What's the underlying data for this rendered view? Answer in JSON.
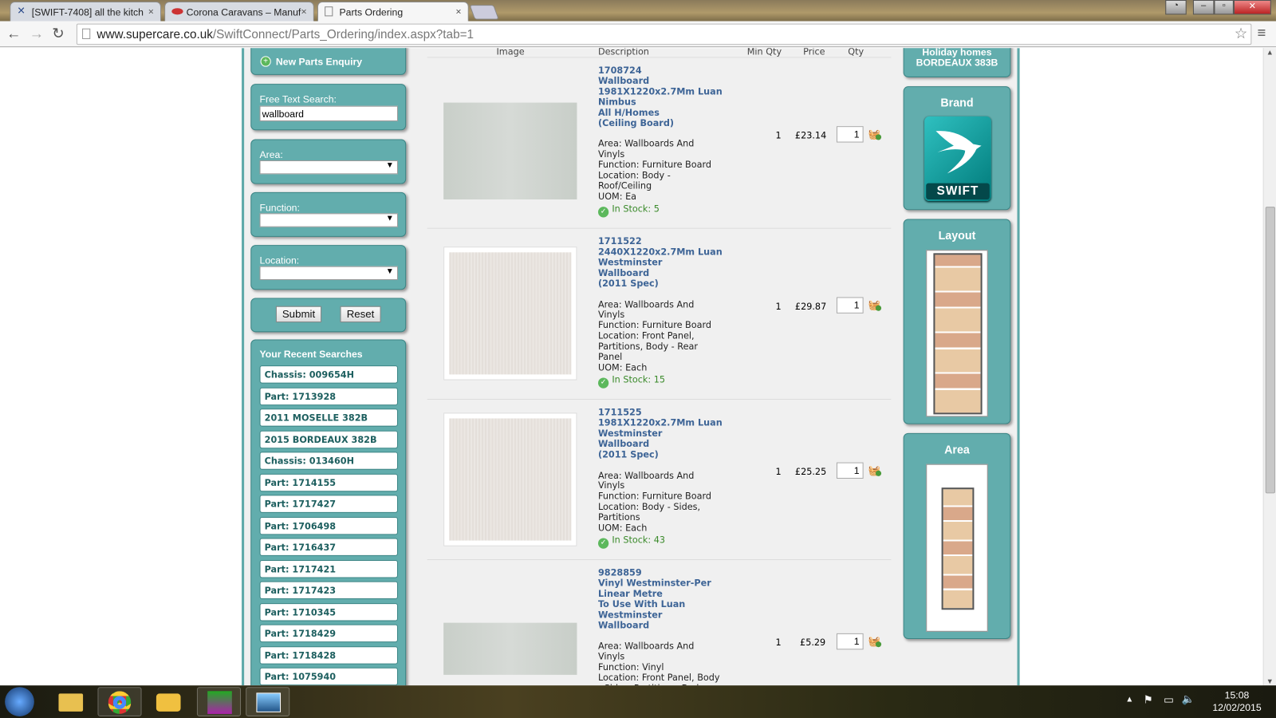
{
  "browser": {
    "tabs": [
      {
        "title": "[SWIFT-7408] all the kitch"
      },
      {
        "title": "Corona Caravans – Manuf"
      },
      {
        "title": "Parts Ordering"
      }
    ],
    "url_host": "www.supercare.co.uk",
    "url_path": "/SwiftConnect/Parts_Ordering/index.aspx?tab=1"
  },
  "sidebar": {
    "new_enquiry": "New Parts Enquiry",
    "free_text_label": "Free Text Search:",
    "free_text_value": "wallboard",
    "area_label": "Area:",
    "function_label": "Function:",
    "location_label": "Location:",
    "submit": "Submit",
    "reset": "Reset",
    "recent_title": "Your Recent Searches",
    "recent": [
      "Chassis: 009654H",
      "Part: 1713928",
      "2011 MOSELLE 382B",
      "2015 BORDEAUX 382B",
      "Chassis: 013460H",
      "Part: 1714155",
      "Part: 1717427",
      "Part: 1706498",
      "Part: 1716437",
      "Part: 1717421",
      "Part: 1717423",
      "Part: 1710345",
      "Part: 1718429",
      "Part: 1718428",
      "Part: 1075940"
    ]
  },
  "results": {
    "headers": {
      "image": "Image",
      "description": "Description",
      "min_qty": "Min Qty",
      "price": "Price",
      "qty": "Qty"
    },
    "rows": [
      {
        "title": "1708724\nWallboard\n1981X1220x2.7Mm Luan\nNimbus\nAll H/Homes\n(Ceiling Board)",
        "details": "Area: Wallboards And\nVinyls\nFunction: Furniture Board\nLocation: Body -\nRoof/Ceiling\nUOM: Ea",
        "stock": "In Stock: 5",
        "min_qty": "1",
        "price": "£23.14",
        "qty": "1"
      },
      {
        "title": "1711522\n2440X1220x2.7Mm Luan\nWestminster\nWallboard\n(2011 Spec)",
        "details": "Area: Wallboards And\nVinyls\nFunction: Furniture Board\nLocation: Front Panel,\nPartitions, Body - Rear\nPanel\nUOM: Each",
        "stock": "In Stock: 15",
        "min_qty": "1",
        "price": "£29.87",
        "qty": "1"
      },
      {
        "title": "1711525\n1981X1220x2.7Mm Luan\nWestminster\nWallboard\n(2011 Spec)",
        "details": "Area: Wallboards And\nVinyls\nFunction: Furniture Board\nLocation: Body - Sides,\nPartitions\nUOM: Each",
        "stock": "In Stock: 43",
        "min_qty": "1",
        "price": "£25.25",
        "qty": "1"
      },
      {
        "title": "9828859\nVinyl Westminster-Per\nLinear Metre\nTo Use With Luan\nWestminster\nWallboard",
        "details": "Area: Wallboards And\nVinyls\nFunction: Vinyl\nLocation: Front Panel, Body\n- Sides, Partitions, Body",
        "min_qty": "1",
        "price": "£5.29",
        "qty": "1"
      }
    ]
  },
  "right": {
    "model_line1": "Holiday homes",
    "model_line2": "BORDEAUX 383B",
    "brand_title": "Brand",
    "brand_logo_text": "SWIFT",
    "layout_title": "Layout",
    "area_title": "Area"
  },
  "taskbar": {
    "time": "15:08",
    "date": "12/02/2015"
  },
  "colors": {
    "teal": "#62adad",
    "link": "#3d6496",
    "stock": "#3a8a2a"
  }
}
